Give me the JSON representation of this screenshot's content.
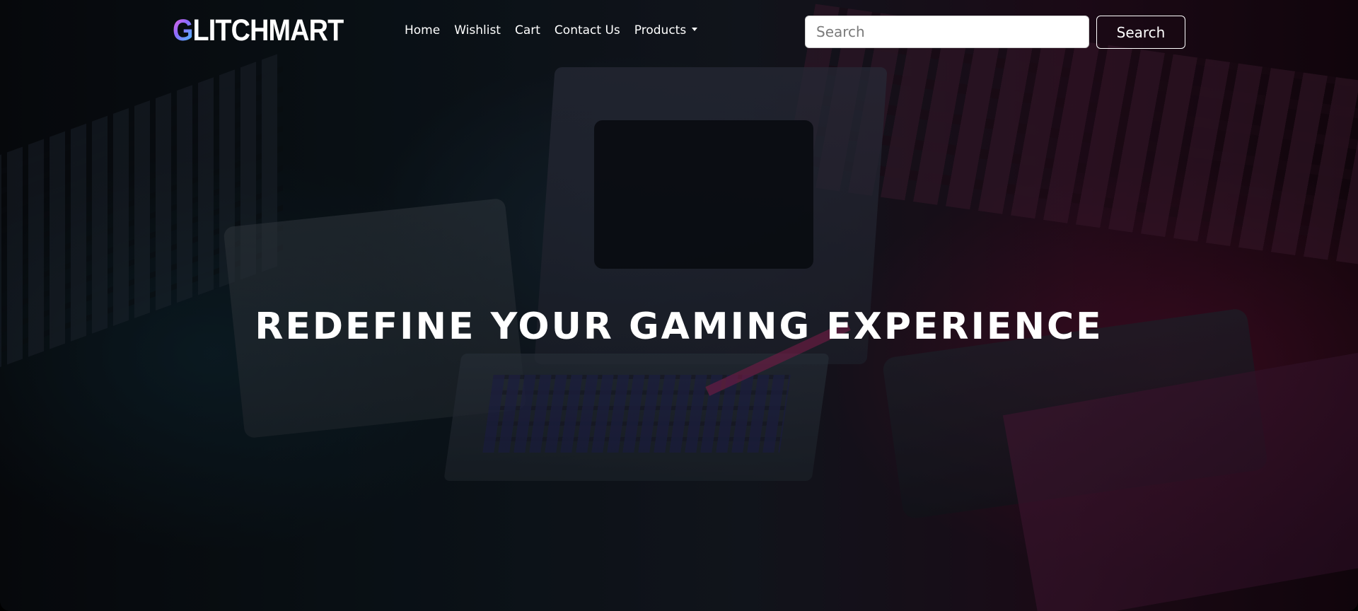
{
  "brand": {
    "first_letter": "G",
    "rest": "LITCHMART"
  },
  "nav": {
    "items": [
      {
        "label": "Home"
      },
      {
        "label": "Wishlist"
      },
      {
        "label": "Cart"
      },
      {
        "label": "Contact Us"
      },
      {
        "label": "Products"
      }
    ]
  },
  "search": {
    "placeholder": "Search",
    "value": "",
    "button_label": "Search"
  },
  "hero": {
    "headline": "REDEFINE YOUR GAMING EXPERIENCE"
  },
  "colors": {
    "brand_gradient": [
      "#ff5fd2",
      "#8a6bff",
      "#3fd0ff"
    ],
    "text": "#ffffff",
    "background": "#000000"
  }
}
